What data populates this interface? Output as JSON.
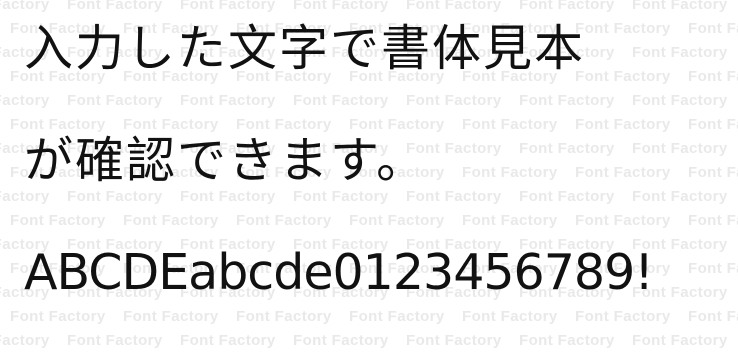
{
  "watermark": {
    "text": "Font Factory"
  },
  "sample": {
    "line1": "入力した文字で書体見本",
    "line2": "が確認できます。",
    "line3": "ABCDEabcde0123456789!"
  },
  "colors": {
    "text": "#111111",
    "watermark": "#e9e9e9",
    "background": "#ffffff"
  }
}
